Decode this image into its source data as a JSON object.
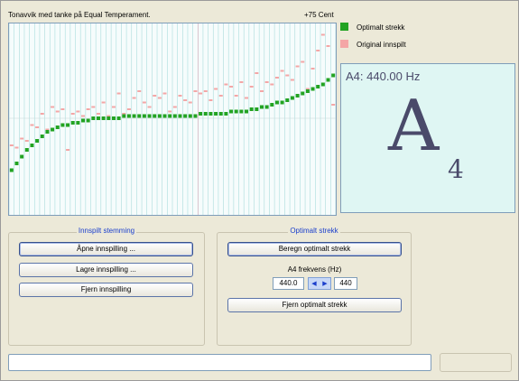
{
  "chart": {
    "title": "Tonavvik med tanke på Equal Temperament.",
    "cent_label": "+75 Cent"
  },
  "legend": {
    "optimal": "Optimalt strekk",
    "original": "Original innspilt",
    "optimal_color": "#22a322",
    "original_color": "#f4a6a6"
  },
  "note": {
    "frequency_text": "A4: 440.00 Hz",
    "letter": "A",
    "octave": "4"
  },
  "recorded_group": {
    "title": "Innspilt stemming",
    "open_label": "Åpne innspilling ...",
    "save_label": "Lagre innspilling ...",
    "remove_label": "Fjern innspilling"
  },
  "optimal_group": {
    "title": "Optimalt strekk",
    "compute_label": "Beregn optimalt strekk",
    "freq_label": "A4 frekvens (Hz)",
    "freq_value": "440.0",
    "freq_target": "440",
    "remove_label": "Fjern optimalt strekk"
  },
  "chart_data": {
    "type": "scatter",
    "title": "Tonavvik med tanke på Equal Temperament.",
    "series": [
      {
        "name": "Optimalt strekk",
        "y": [
          -23,
          -20,
          -17,
          -14,
          -12,
          -10,
          -8,
          -6,
          -5,
          -4,
          -3,
          -3,
          -2,
          -2,
          -1,
          -1,
          0,
          0,
          0,
          0,
          0,
          0,
          1,
          1,
          1,
          1,
          1,
          1,
          1,
          1,
          1,
          1,
          1,
          1,
          1,
          1,
          1,
          2,
          2,
          2,
          2,
          2,
          2,
          3,
          3,
          3,
          3,
          4,
          4,
          5,
          5,
          6,
          7,
          7,
          8,
          9,
          10,
          11,
          12,
          13,
          14,
          15,
          17,
          19
        ]
      },
      {
        "name": "Original innspilt",
        "y": [
          -12,
          -13,
          -9,
          -10,
          -3,
          -4,
          2,
          -5,
          5,
          3,
          4,
          -14,
          2,
          3,
          1,
          4,
          5,
          2,
          7,
          1,
          5,
          11,
          2,
          4,
          9,
          12,
          7,
          5,
          10,
          9,
          11,
          3,
          5,
          10,
          8,
          7,
          12,
          11,
          12,
          8,
          13,
          10,
          15,
          14,
          10,
          16,
          9,
          14,
          20,
          12,
          16,
          15,
          18,
          21,
          19,
          17,
          23,
          25,
          13,
          22,
          30,
          37,
          32,
          6
        ]
      }
    ]
  }
}
